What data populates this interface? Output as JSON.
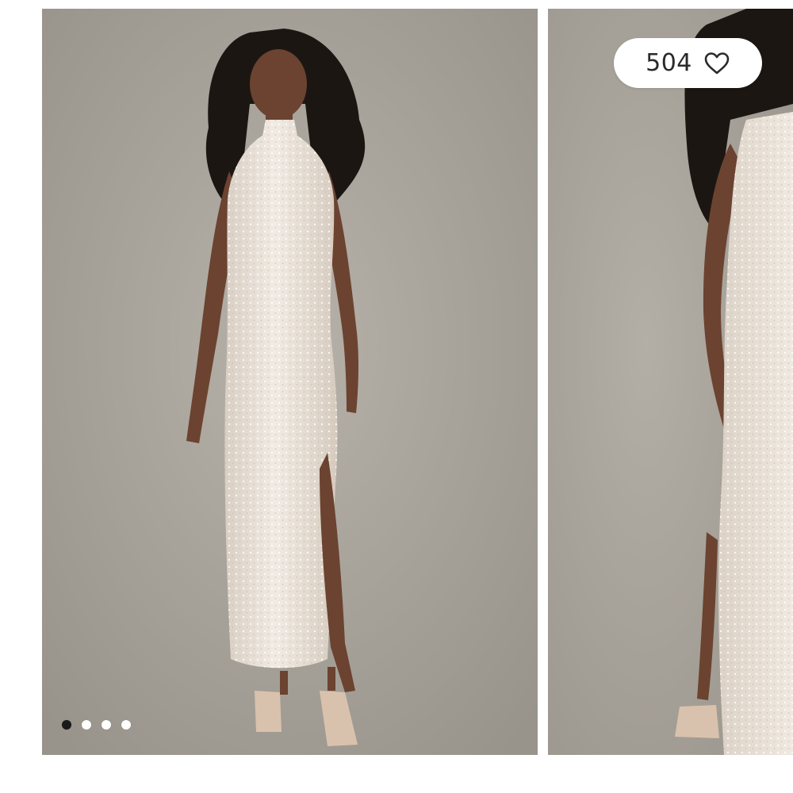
{
  "gallery": {
    "like_count": "504",
    "slides": [
      {
        "name": "product-image-front",
        "icon": "model-front-photo"
      },
      {
        "name": "product-image-back",
        "icon": "model-back-photo"
      }
    ],
    "pagination": {
      "total": 4,
      "active_index": 0
    }
  },
  "colors": {
    "backdrop": "#a8a39b",
    "dress": "#e9e1d8",
    "skin": "#6b4330",
    "hair": "#1c1613",
    "active_dot": "#1a1a1a",
    "inactive_dot": "#ffffff"
  }
}
